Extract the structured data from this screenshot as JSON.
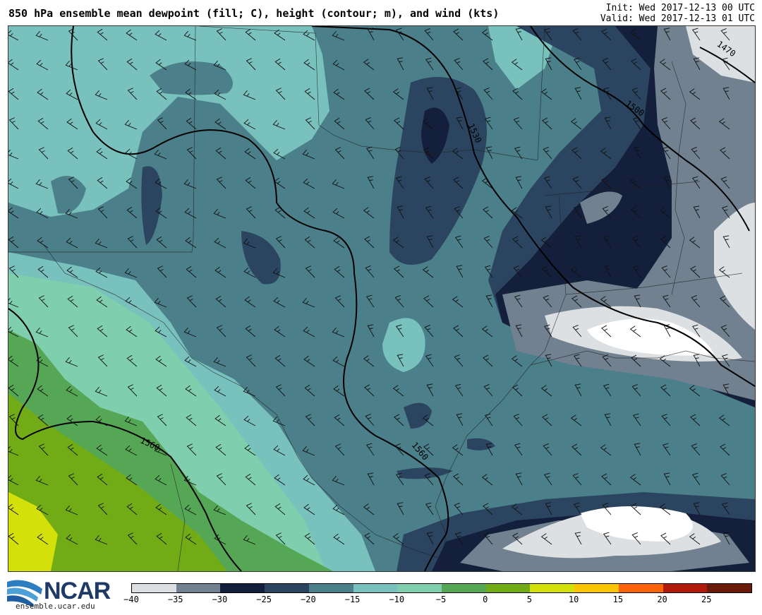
{
  "header": {
    "title": "850 hPa ensemble mean dewpoint (fill; C), height (contour; m), and wind (kts)",
    "init": "Init: Wed 2017-12-13 00 UTC",
    "valid": "Valid: Wed 2017-12-13 01 UTC"
  },
  "map": {
    "contour_labels": [
      "1470",
      "1500",
      "1530",
      "1560",
      "1560"
    ],
    "fill_colors": {
      "very_dry": "#dde0e3",
      "dry_grey": "#718190",
      "dark_navy": "#141f3c",
      "navy": "#2b4560",
      "teal": "#4b7f89",
      "teal_light": "#78c1bd",
      "mint": "#7fcfae",
      "green": "#56a755",
      "olive": "#71ac17",
      "yellow_green": "#d3e00a"
    }
  },
  "colorbar": {
    "colors": [
      "#dde0e3",
      "#718190",
      "#141f3c",
      "#2b4560",
      "#4b7f89",
      "#78c1bd",
      "#7fcfae",
      "#56a755",
      "#71ac17",
      "#d3e00a",
      "#fdc401",
      "#fc6208",
      "#b11a0b",
      "#691a0b"
    ],
    "tick_labels": [
      "−40",
      "−35",
      "−30",
      "−25",
      "−20",
      "−15",
      "−10",
      "−5",
      "0",
      "5",
      "10",
      "15",
      "20",
      "25"
    ]
  },
  "logo": {
    "text": "NCAR",
    "site": "ensemble.ucar.edu"
  }
}
